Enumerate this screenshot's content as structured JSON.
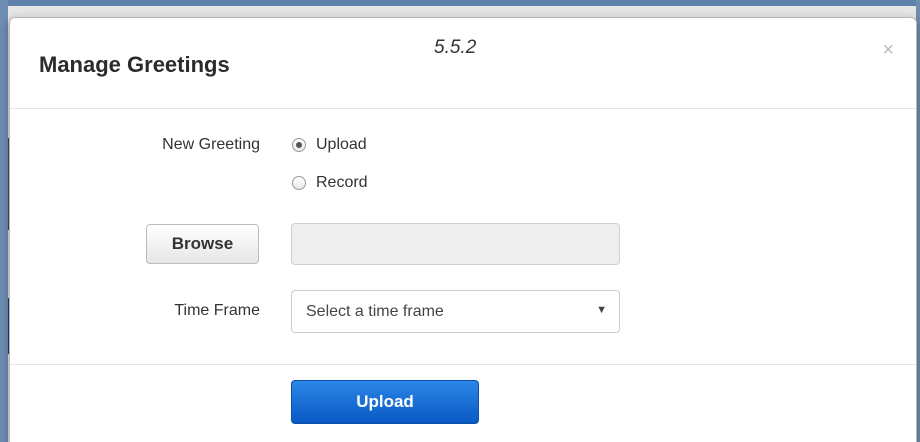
{
  "modal": {
    "title": "Manage Greetings",
    "version": "5.5.2",
    "close_label": "×"
  },
  "form": {
    "new_greeting_label": "New Greeting",
    "radio_options": [
      {
        "label": "Upload",
        "checked": true
      },
      {
        "label": "Record",
        "checked": false
      }
    ],
    "browse_label": "Browse",
    "file_value": "",
    "time_frame_label": "Time Frame",
    "time_frame_selected": "Select a time frame",
    "select_arrow": "▼"
  },
  "footer": {
    "upload_label": "Upload"
  },
  "colors": {
    "primary_button": "#0a59c4",
    "overlay_band_dark": "#4b4b4b",
    "overlay_band_blue": "#1e4670"
  }
}
